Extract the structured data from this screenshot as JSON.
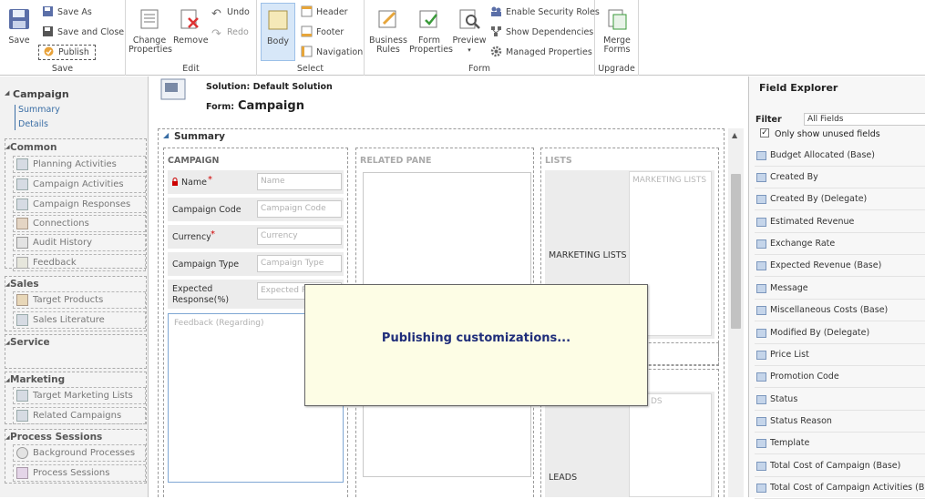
{
  "ribbon": {
    "save": {
      "save": "Save",
      "save_as": "Save As",
      "save_close": "Save and Close",
      "publish": "Publish",
      "group": "Save"
    },
    "edit": {
      "change_properties": [
        "Change",
        "Properties"
      ],
      "remove": "Remove",
      "undo": "Undo",
      "redo": "Redo",
      "group": "Edit"
    },
    "select": {
      "body": "Body",
      "header": "Header",
      "footer": "Footer",
      "navigation": "Navigation",
      "group": "Select"
    },
    "form": {
      "business_rules": [
        "Business",
        "Rules"
      ],
      "form_properties": [
        "Form",
        "Properties"
      ],
      "preview": "Preview",
      "enable_security_roles": "Enable Security Roles",
      "show_dependencies": "Show Dependencies",
      "managed_properties": "Managed Properties",
      "group": "Form"
    },
    "upgrade": {
      "merge_forms": [
        "Merge",
        "Forms"
      ],
      "group": "Upgrade"
    }
  },
  "nav": {
    "entity": "Campaign",
    "subitems": [
      "Summary",
      "Details"
    ],
    "sections": [
      {
        "title": "Common",
        "items": [
          "Planning Activities",
          "Campaign Activities",
          "Campaign Responses",
          "Connections",
          "Audit History",
          "Feedback"
        ]
      },
      {
        "title": "Sales",
        "items": [
          "Target Products",
          "Sales Literature"
        ]
      },
      {
        "title": "Service",
        "items": []
      },
      {
        "title": "Marketing",
        "items": [
          "Target Marketing Lists",
          "Related Campaigns"
        ]
      },
      {
        "title": "Process Sessions",
        "items": [
          "Background Processes",
          "Process Sessions"
        ]
      }
    ]
  },
  "header": {
    "solution": "Solution: Default Solution",
    "form_label": "Form:",
    "form_name": "Campaign"
  },
  "form": {
    "tab_title": "Summary",
    "campaign_section": "CAMPAIGN",
    "related_pane": "RELATED PANE",
    "lists_section": "LISTS",
    "fields": [
      {
        "label": "Name",
        "required": true,
        "placeholder": "Name"
      },
      {
        "label": "Campaign Code",
        "required": false,
        "placeholder": "Campaign Code"
      },
      {
        "label": "Currency",
        "required": true,
        "placeholder": "Currency"
      },
      {
        "label": "Campaign Type",
        "required": false,
        "placeholder": "Campaign Type"
      },
      {
        "label": "Expected Response(%)",
        "required": false,
        "placeholder": "Expected Re"
      }
    ],
    "feedback_placeholder": "Feedback (Regarding)",
    "marketing_lists_label": "MARKETING LISTS",
    "marketing_lists_grid": "MARKETING LISTS",
    "leads_label": "LEADS",
    "leads_grid_partial": "DS"
  },
  "overlay": {
    "message": "Publishing customizations..."
  },
  "field_explorer": {
    "title": "Field Explorer",
    "filter_label": "Filter",
    "filter_value": "All Fields",
    "only_unused": "Only show unused fields",
    "only_unused_checked": true,
    "fields": [
      "Budget Allocated (Base)",
      "Created By",
      "Created By (Delegate)",
      "Estimated Revenue",
      "Exchange Rate",
      "Expected Revenue (Base)",
      "Message",
      "Miscellaneous Costs (Base)",
      "Modified By (Delegate)",
      "Price List",
      "Promotion Code",
      "Status",
      "Status Reason",
      "Template",
      "Total Cost of Campaign (Base)",
      "Total Cost of Campaign Activities (Base)"
    ]
  },
  "colors": {
    "accent_blue": "#3a6ea5",
    "overlay_bg": "#fdfde5",
    "overlay_text": "#1f2d7a",
    "body_selected": "#d7e7f8",
    "required_red": "#d00000"
  }
}
